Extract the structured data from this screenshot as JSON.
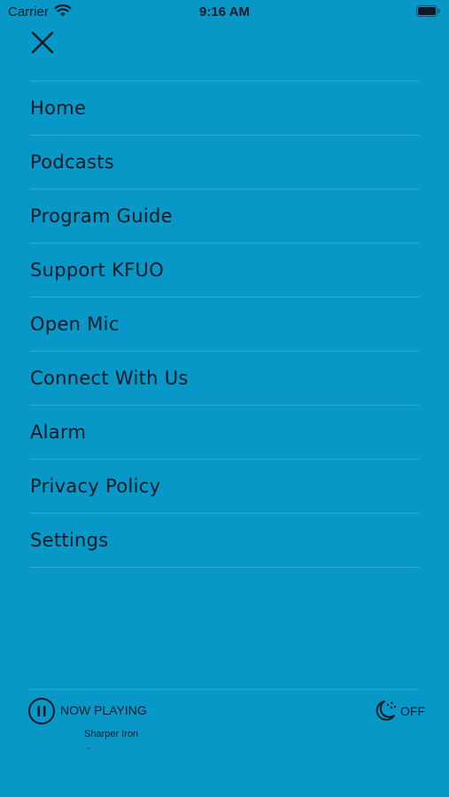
{
  "status_bar": {
    "carrier": "Carrier",
    "time": "9:16 AM",
    "icons": [
      "wifi-icon",
      "battery-icon"
    ]
  },
  "menu": {
    "close_icon": "close-icon",
    "items": [
      {
        "label": "Home"
      },
      {
        "label": "Podcasts"
      },
      {
        "label": "Program Guide"
      },
      {
        "label": "Support KFUO"
      },
      {
        "label": "Open Mic"
      },
      {
        "label": "Connect With Us"
      },
      {
        "label": "Alarm"
      },
      {
        "label": "Privacy Policy"
      },
      {
        "label": "Settings"
      }
    ]
  },
  "player": {
    "play_pause_icon": "pause-icon",
    "now_playing_label": "NOW PLAYING",
    "track_title": "Sharper Iron",
    "track_subtitle": "-",
    "sleep_timer_icon": "moon-icon",
    "sleep_timer_label": "OFF"
  },
  "colors": {
    "background": "#0798c8",
    "text": "#0b1a24"
  }
}
